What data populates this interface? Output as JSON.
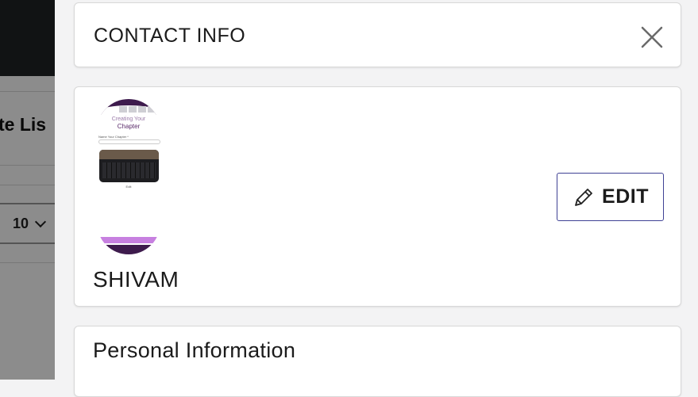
{
  "background_page": {
    "title_fragment": "te Lis",
    "page_size_value": "10"
  },
  "drawer": {
    "header": {
      "title": "CONTACT INFO"
    },
    "profile": {
      "name": "SHIVAM",
      "edit_label": "EDIT",
      "avatar_thumbnail": {
        "heading_line1": "Creating Your",
        "heading_line2": "Chapter",
        "field_label": "Name Your Chapter *",
        "caption": "Edit"
      }
    },
    "personal_section": {
      "title": "Personal Information"
    }
  },
  "icons": {
    "close": "close-icon",
    "edit": "pencil-icon"
  },
  "colors": {
    "accent": "#3f4194",
    "avatar_purple": "#3e1b4d",
    "avatar_button": "#c780e0"
  }
}
